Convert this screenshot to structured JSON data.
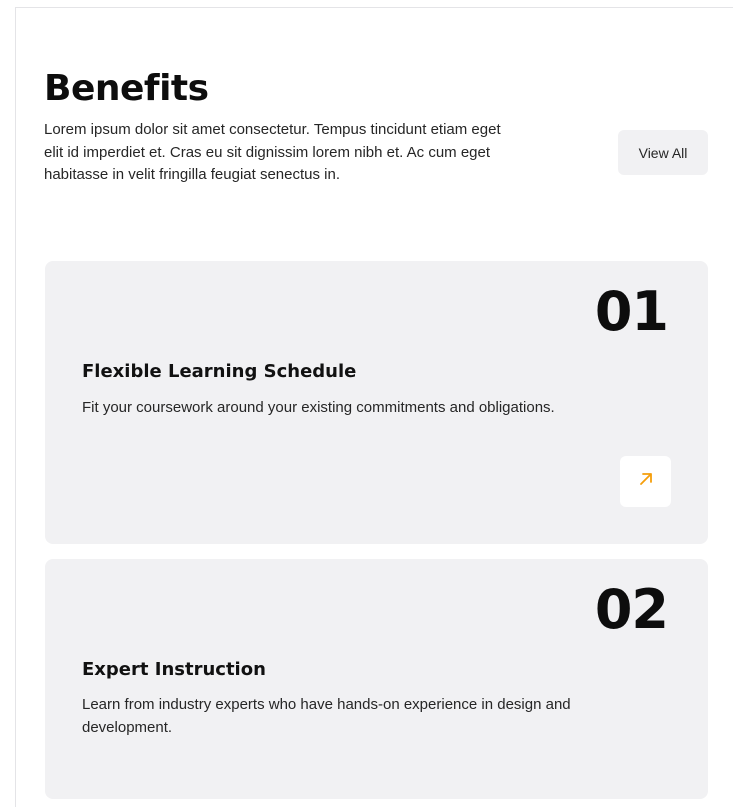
{
  "header": {
    "title": "Benefits",
    "description": "Lorem ipsum dolor sit amet consectetur. Tempus tincidunt etiam eget elit id imperdiet et. Cras eu sit dignissim lorem nibh et. Ac cum eget habitasse in velit fringilla feugiat senectus in.",
    "view_all_label": "View All"
  },
  "cards": [
    {
      "number": "01",
      "title": "Flexible Learning Schedule",
      "text": "Fit your coursework around your existing commitments and obligations.",
      "action_icon": "arrow-up-right-icon"
    },
    {
      "number": "02",
      "title": "Expert Instruction",
      "text": "Learn from industry experts who have hands-on experience in design and development."
    }
  ],
  "colors": {
    "accent": "#f59e0b",
    "card_bg": "#f1f1f3",
    "heading": "#0d0d0d"
  }
}
